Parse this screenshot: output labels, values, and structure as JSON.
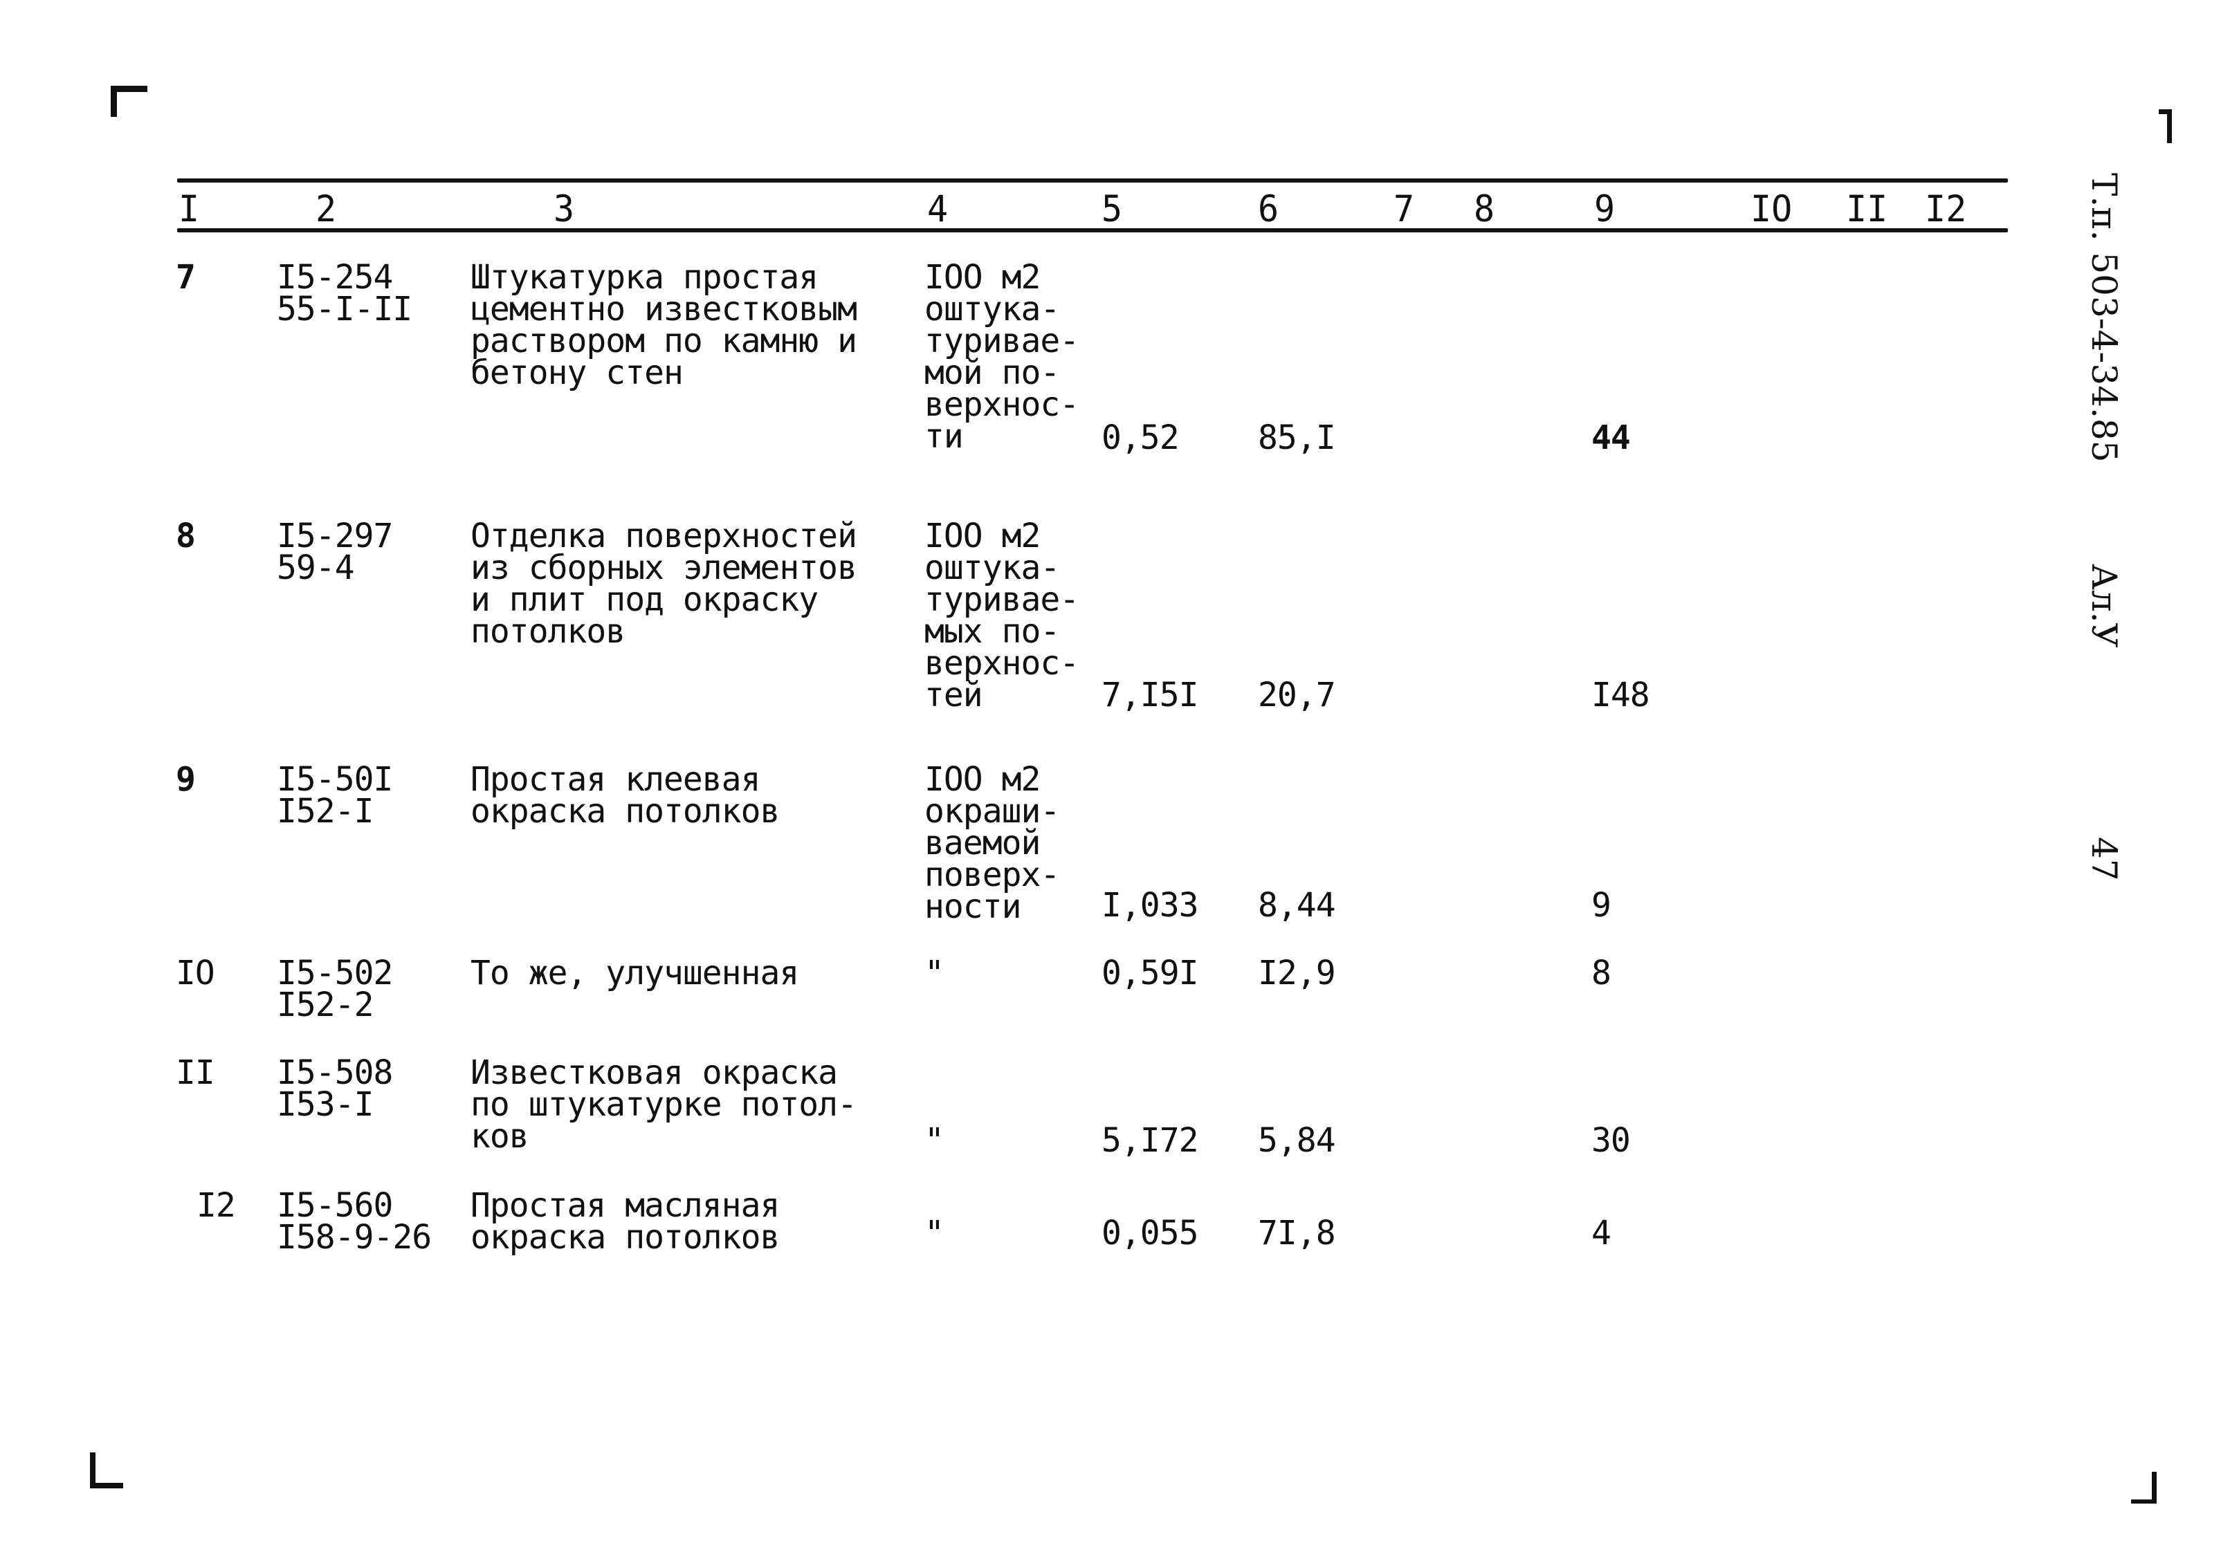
{
  "columns": [
    "I",
    "2",
    "3",
    "4",
    "5",
    "6",
    "7",
    "8",
    "9",
    "IO",
    "II",
    "I2"
  ],
  "rows": [
    {
      "num": "7",
      "code": [
        "I5-254",
        "55-I-II"
      ],
      "description": [
        "Штукатурка простая",
        "цементно известковым",
        "раствором по камню и",
        "бетону стен"
      ],
      "unit": [
        "IOO м2",
        "оштука-",
        "туривае-",
        "мой по-",
        "верхнос-",
        "ти"
      ],
      "col5": "0,52",
      "col6": "85,I",
      "col9": "44"
    },
    {
      "num": "8",
      "code": [
        "I5-297",
        "59-4"
      ],
      "description": [
        "Отделка поверхностей",
        "из сборных элементов",
        "и плит под окраску",
        "потолков"
      ],
      "unit": [
        "IOO м2",
        "оштука-",
        "туривае-",
        "мых по-",
        "верхнос-",
        "тей"
      ],
      "col5": "7,I5I",
      "col6": "20,7",
      "col9": "I48"
    },
    {
      "num": "9",
      "code": [
        "I5-50I",
        "I52-I"
      ],
      "description": [
        "Простая клеевая",
        "окраска потолков"
      ],
      "unit": [
        "IOO м2",
        "окраши-",
        "ваемой",
        "поверх-",
        "ности"
      ],
      "col5": "I,033",
      "col6": "8,44",
      "col9": "9"
    },
    {
      "num": "IO",
      "code": [
        "I5-502",
        "I52-2"
      ],
      "description": [
        "То же, улучшенная"
      ],
      "unit": [
        "\""
      ],
      "col5": "0,59I",
      "col6": "I2,9",
      "col9": "8"
    },
    {
      "num": "II",
      "code": [
        "I5-508",
        "I53-I"
      ],
      "description": [
        "Известковая окраска",
        "по штукатурке потол-",
        "ков"
      ],
      "unit": [
        "\""
      ],
      "col5": "5,I72",
      "col6": "5,84",
      "col9": "30"
    },
    {
      "num": "I2",
      "code": [
        "I5-560",
        "I58-9-26"
      ],
      "description": [
        "Простая масляная",
        "окраска потолков"
      ],
      "unit": [
        "\""
      ],
      "col5": "0,055",
      "col6": "7I,8",
      "col9": "4"
    }
  ],
  "side_labels": {
    "document_code": "Т.п. 503-4-34.85",
    "album": "Ал.У",
    "page": "47"
  }
}
